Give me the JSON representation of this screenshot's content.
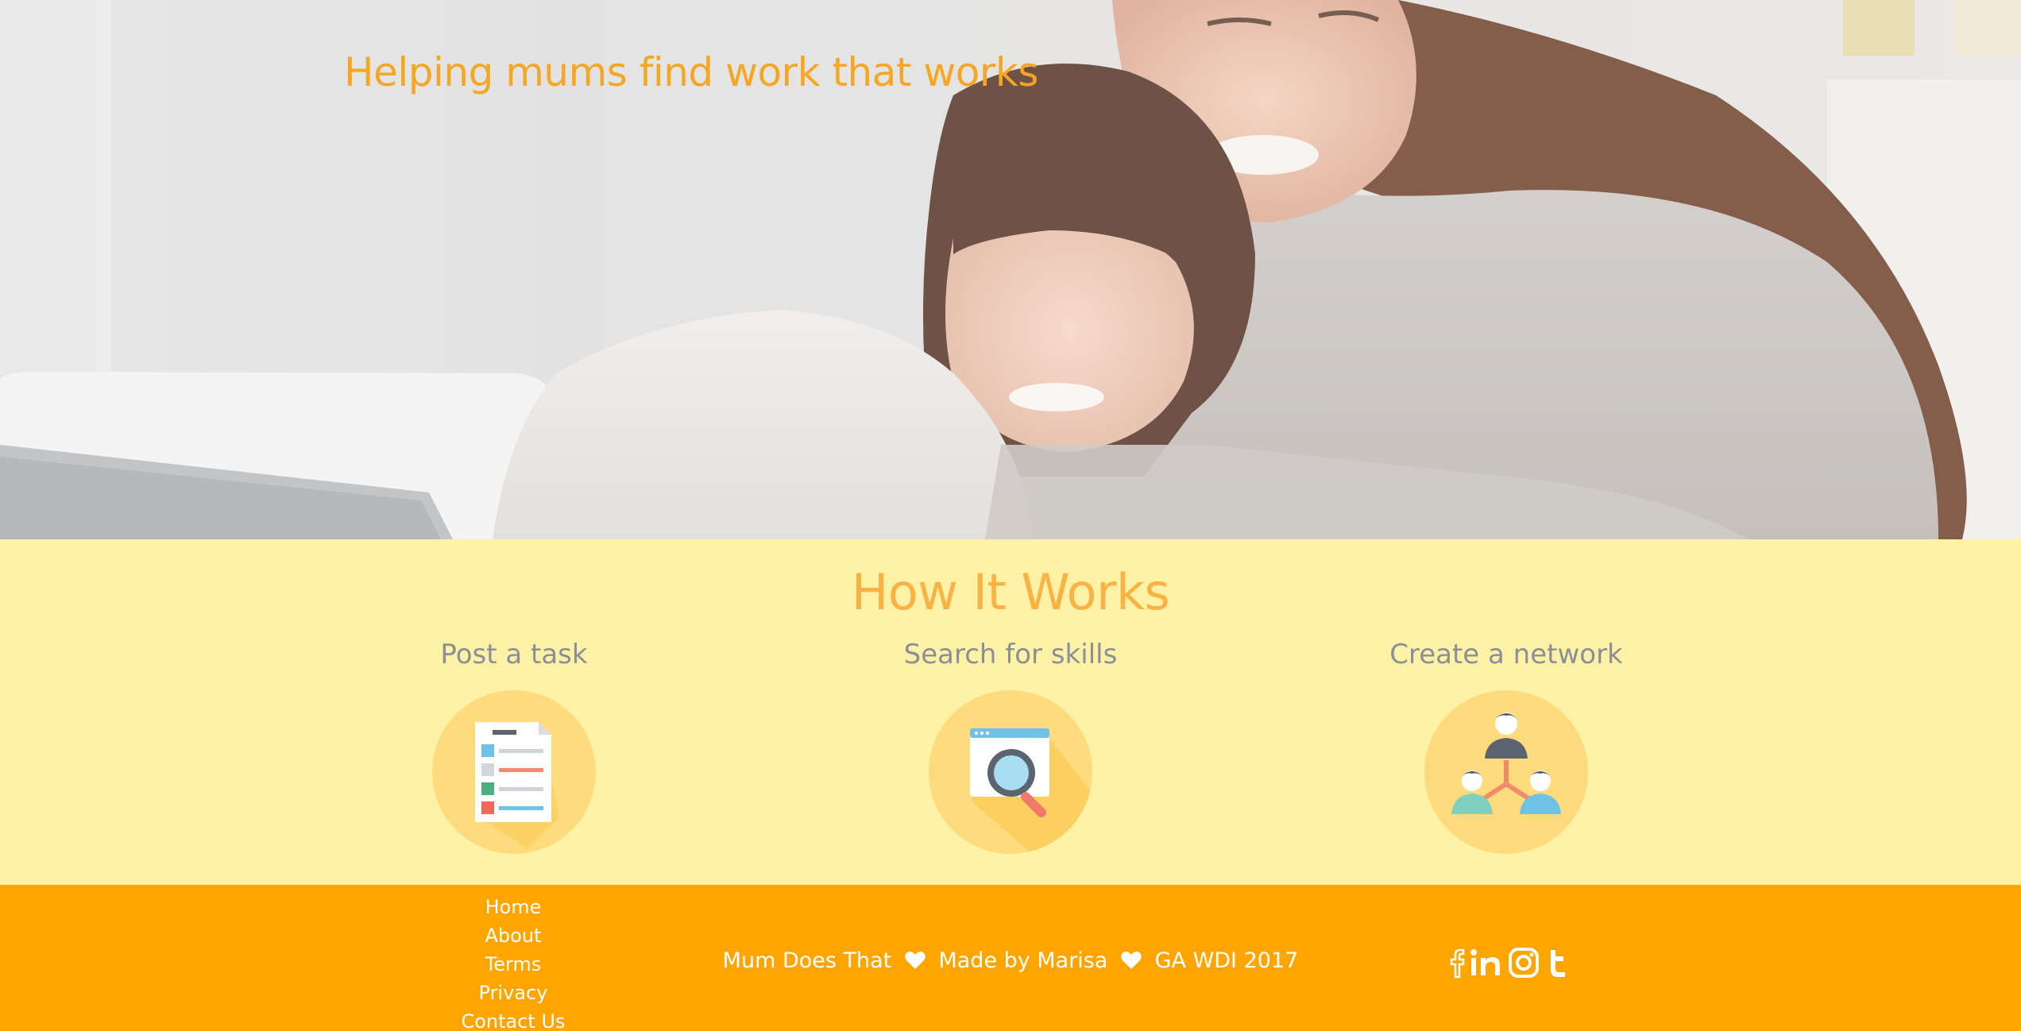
{
  "hero": {
    "tagline": "Helping mums find work that works"
  },
  "how_it_works": {
    "title": "How It Works",
    "steps": [
      {
        "title": "Post a task",
        "icon": "document-list-icon"
      },
      {
        "title": "Search for skills",
        "icon": "magnifying-glass-browser-icon"
      },
      {
        "title": "Create a network",
        "icon": "people-network-icon"
      }
    ]
  },
  "footer": {
    "links": [
      "Home",
      "About",
      "Terms",
      "Privacy",
      "Contact Us"
    ],
    "credit": {
      "part1": "Mum Does That",
      "part2": "Made by Marisa",
      "part3": "GA WDI 2017"
    },
    "social": [
      "facebook-icon",
      "linkedin-icon",
      "instagram-icon",
      "tumblr-icon"
    ]
  },
  "colors": {
    "accent": "#f5a623",
    "section_bg": "#fff1a6",
    "footer_bg": "#fea501",
    "icon_circle": "#fedc7d",
    "step_text": "#8b8f96"
  }
}
